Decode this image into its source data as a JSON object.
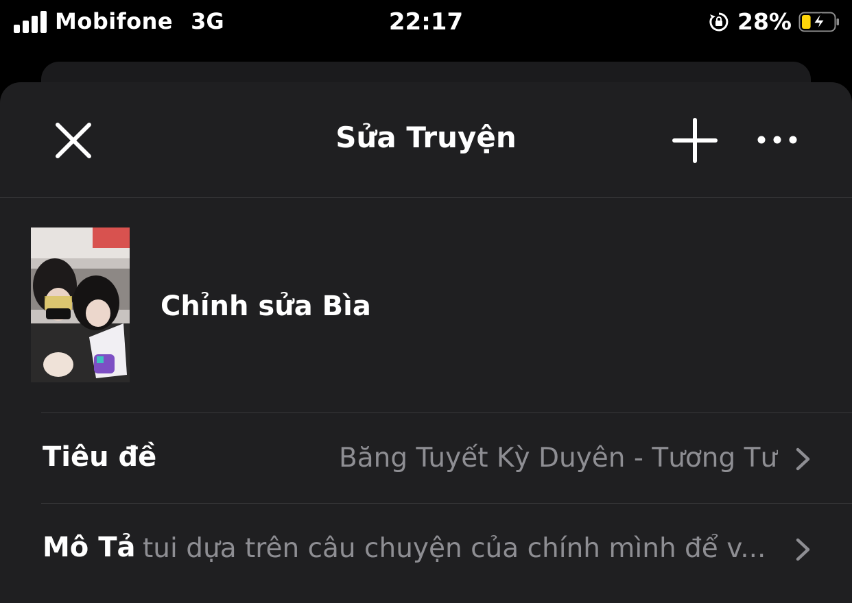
{
  "status_bar": {
    "carrier": "Mobifone",
    "network": "3G",
    "time": "22:17",
    "battery_percent": "28%",
    "battery_level": 0.28,
    "battery_color": "#ffd60a",
    "charging": true
  },
  "nav": {
    "title": "Sửa Truyện",
    "close_icon": "close-icon",
    "add_icon": "plus-icon",
    "more_icon": "more-icon"
  },
  "cover": {
    "label": "Chỉnh sửa Bìa"
  },
  "fields": {
    "title_label": "Tiêu đề",
    "title_value": "Băng Tuyết Kỳ Duyên - Tương Tư",
    "description_label": "Mô Tả",
    "description_value": "tui dựa trên câu chuyện của chính mình để v..."
  },
  "colors": {
    "background": "#000000",
    "sheet": "#1f1f21",
    "secondary_text": "#8e8e93",
    "separator": "#3a3a3c"
  }
}
